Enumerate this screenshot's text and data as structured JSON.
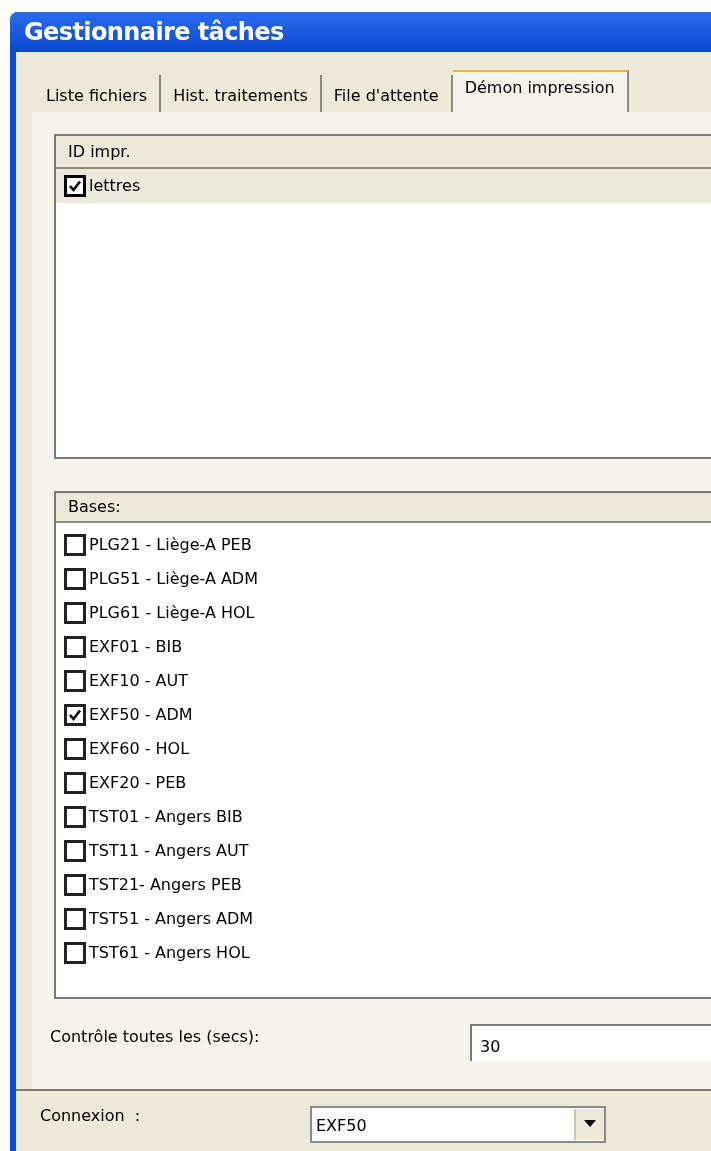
{
  "window": {
    "title": "Gestionnaire tâches"
  },
  "tabs": [
    {
      "label": "Liste fichiers",
      "selected": false
    },
    {
      "label": "Hist. traitements",
      "selected": false
    },
    {
      "label": "File d'attente",
      "selected": false
    },
    {
      "label": "Démon impression",
      "selected": true
    }
  ],
  "printers": {
    "header": "ID impr.",
    "items": [
      {
        "label": "lettres",
        "checked": true,
        "selected": true
      }
    ]
  },
  "bases": {
    "header": "Bases:",
    "items": [
      {
        "label": "PLG21 - Liège-A PEB",
        "checked": false
      },
      {
        "label": "PLG51 - Liège-A ADM",
        "checked": false
      },
      {
        "label": "PLG61 - Liège-A HOL",
        "checked": false
      },
      {
        "label": "EXF01 - BIB",
        "checked": false
      },
      {
        "label": "EXF10 - AUT",
        "checked": false
      },
      {
        "label": "EXF50 - ADM",
        "checked": true
      },
      {
        "label": "EXF60 - HOL",
        "checked": false
      },
      {
        "label": "EXF20 - PEB",
        "checked": false
      },
      {
        "label": "TST01 - Angers BIB",
        "checked": false
      },
      {
        "label": "TST11 - Angers AUT",
        "checked": false
      },
      {
        "label": "TST21- Angers PEB",
        "checked": false
      },
      {
        "label": "TST51 - Angers ADM",
        "checked": false
      },
      {
        "label": "TST61 - Angers HOL",
        "checked": false
      }
    ]
  },
  "interval": {
    "label": "Contrôle toutes les (secs):",
    "value": "30"
  },
  "connection": {
    "label": "Connexion  :",
    "value": "EXF50"
  }
}
